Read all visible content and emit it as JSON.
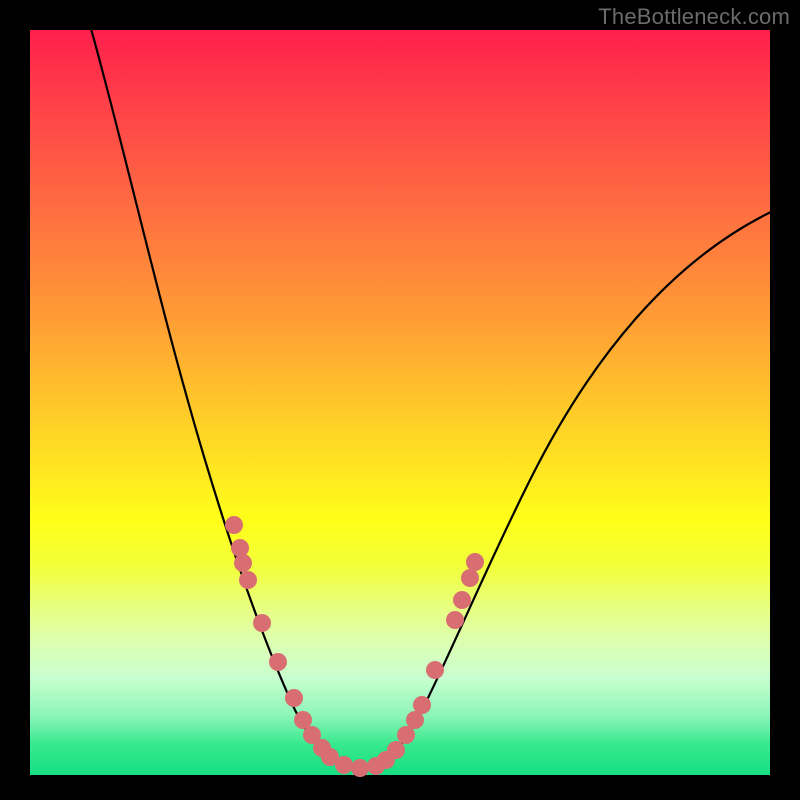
{
  "watermark": "TheBottleneck.com",
  "colors": {
    "frame": "#000000",
    "curve": "#000000",
    "dots": "#d96e72"
  },
  "chart_data": {
    "type": "line",
    "title": "",
    "xlabel": "",
    "ylabel": "",
    "xlim": [
      0,
      100
    ],
    "ylim": [
      0,
      100
    ],
    "grid": false,
    "legend": false,
    "series": [
      {
        "name": "bottleneck-curve",
        "data_note": "V-shaped bottleneck curve; y≈0 around x≈40–50, rising steeply outward",
        "x": [
          10,
          15,
          20,
          25,
          27,
          29,
          31,
          33,
          35,
          37,
          39,
          41,
          43,
          45,
          47,
          49,
          51,
          53,
          55,
          58,
          62,
          70,
          80,
          90,
          100
        ],
        "y": [
          100,
          82,
          65,
          48,
          41,
          34,
          27,
          21,
          16,
          11,
          7,
          4,
          2,
          1,
          1,
          2,
          4,
          8,
          12,
          18,
          26,
          40,
          55,
          67,
          76
        ]
      }
    ],
    "markers": {
      "name": "highlighted-dots",
      "note": "salmon dots clustered near the trough on both arms",
      "points": [
        {
          "x": 29,
          "y": 34
        },
        {
          "x": 30,
          "y": 30
        },
        {
          "x": 30.5,
          "y": 28
        },
        {
          "x": 31,
          "y": 26
        },
        {
          "x": 33,
          "y": 20
        },
        {
          "x": 35,
          "y": 15
        },
        {
          "x": 37,
          "y": 10
        },
        {
          "x": 38,
          "y": 7
        },
        {
          "x": 39,
          "y": 5
        },
        {
          "x": 40,
          "y": 3
        },
        {
          "x": 41,
          "y": 2
        },
        {
          "x": 43,
          "y": 1
        },
        {
          "x": 45,
          "y": 1
        },
        {
          "x": 47,
          "y": 1
        },
        {
          "x": 48,
          "y": 2
        },
        {
          "x": 49,
          "y": 3
        },
        {
          "x": 50,
          "y": 5
        },
        {
          "x": 51,
          "y": 7
        },
        {
          "x": 52,
          "y": 9
        },
        {
          "x": 54,
          "y": 14
        },
        {
          "x": 57,
          "y": 21
        },
        {
          "x": 58,
          "y": 24
        },
        {
          "x": 59,
          "y": 27
        },
        {
          "x": 59.5,
          "y": 29
        }
      ]
    }
  }
}
